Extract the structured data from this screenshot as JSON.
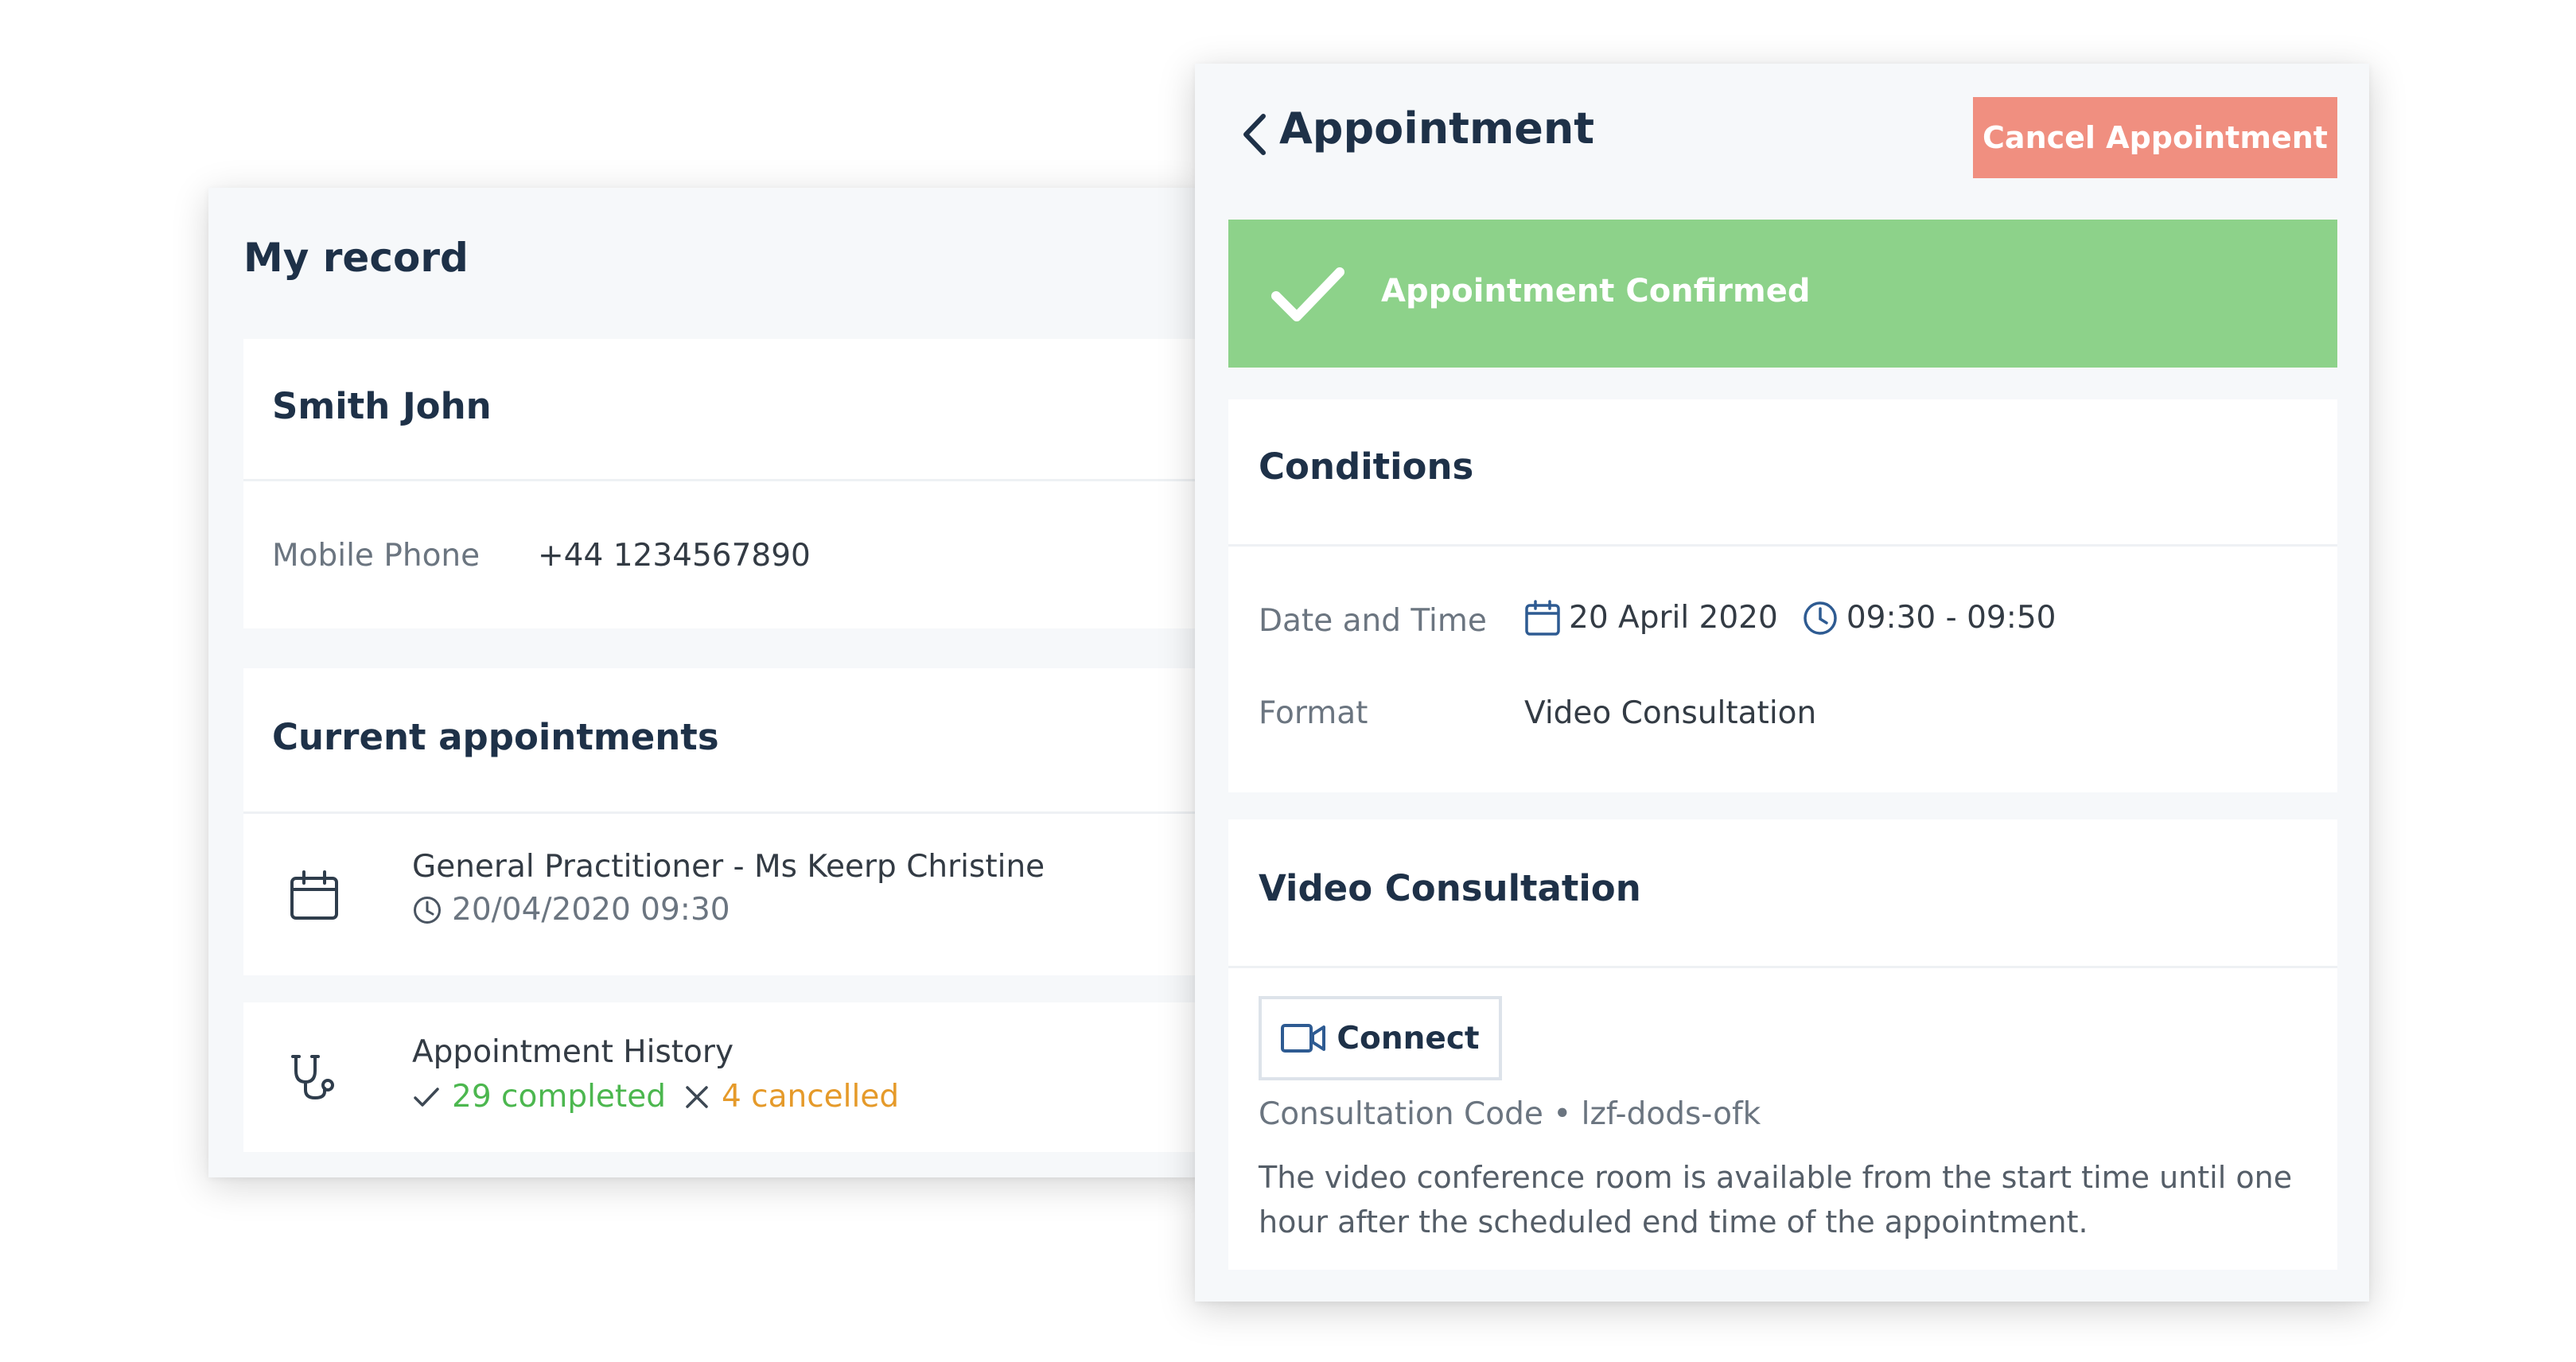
{
  "record": {
    "title": "My record",
    "patient_name": "Smith John",
    "phone_label": "Mobile Phone",
    "phone_value": "+44 1234567890",
    "current_heading": "Current appointments",
    "appointment_item": {
      "title": "General Practitioner - Ms Keerp Christine",
      "datetime": "20/04/2020 09:30",
      "icon": "calendar-icon"
    },
    "history_item": {
      "title": "Appointment History",
      "completed": "29 completed",
      "cancelled": "4 cancelled",
      "icon": "stethoscope-icon"
    }
  },
  "appointment": {
    "title": "Appointment",
    "cancel_label": "Cancel Appointment",
    "confirmed_label": "Appointment Confirmed",
    "conditions_heading": "Conditions",
    "date_time_label": "Date and Time",
    "date_value": "20 April 2020",
    "time_value": "09:30 - 09:50",
    "format_label": "Format",
    "format_value": "Video Consultation",
    "video_heading": "Video Consultation",
    "connect_label": "Connect",
    "code_text": "Consultation Code • lzf-dods-ofk",
    "note_text": "The video conference room is available from the start time until one hour after the scheduled end time of the appointment."
  },
  "colors": {
    "heading": "#1e3148",
    "cancel_button": "#f08f80",
    "confirmed_banner": "#8dd28a",
    "completed": "#4cb74f",
    "cancelled": "#e59a2a"
  }
}
